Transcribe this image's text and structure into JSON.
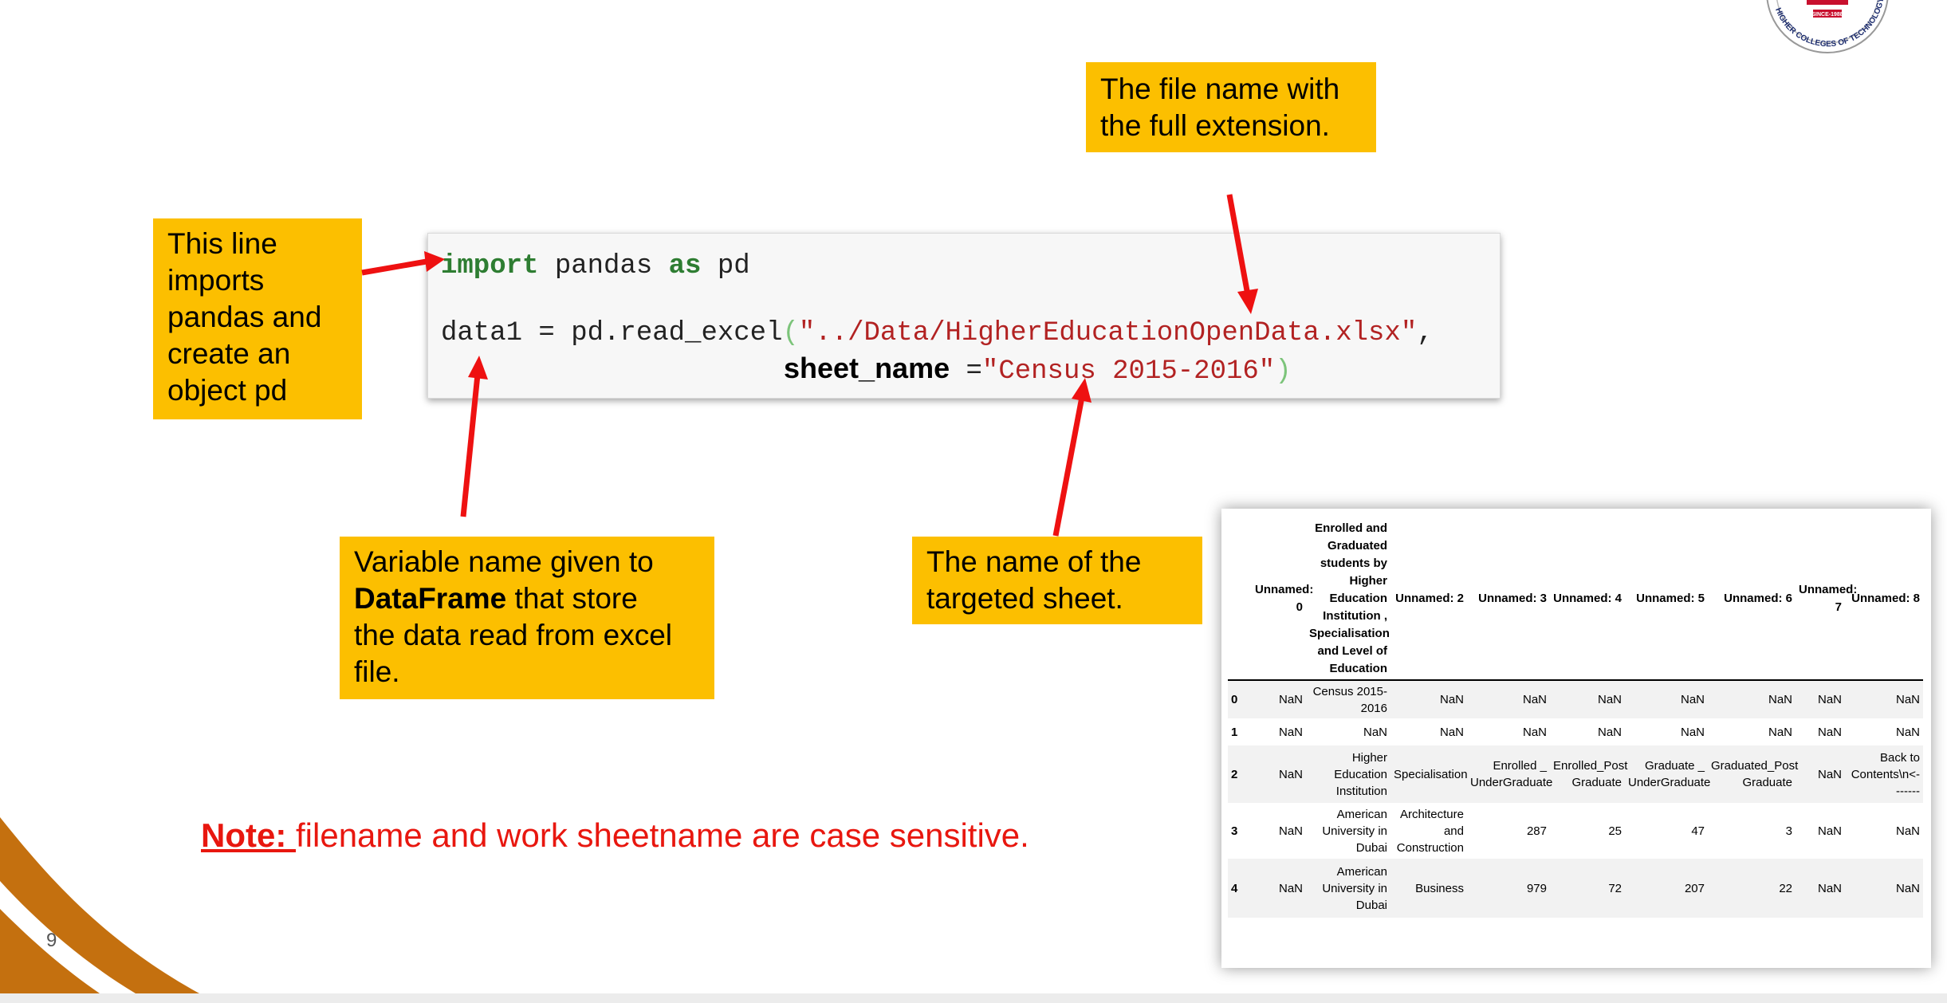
{
  "callouts": {
    "import_note": [
      "This line",
      "imports",
      "pandas and",
      "create an",
      "object pd"
    ],
    "filename_note": [
      "The file name with",
      "the full extension."
    ],
    "variable_note": {
      "pre": "Variable name given to",
      "bold": "DataFrame",
      "post": " that store",
      "line3": "the data read from excel",
      "line4": "file."
    },
    "sheet_note": [
      "The name of the",
      "targeted sheet."
    ]
  },
  "code": {
    "line1": {
      "kw1": "import",
      "mid": " pandas ",
      "kw2": "as",
      "end": " pd"
    },
    "line2": {
      "pre": "data1 = pd.read_excel",
      "open": "(",
      "str": "\"../Data/HigherEducationOpenData.xlsx\"",
      "end": ","
    },
    "line3": {
      "label": "sheet_name",
      "eq": " =",
      "str": "\"Census 2015-2016\"",
      "close": ")"
    }
  },
  "note": {
    "label": "Note: ",
    "text": "filename and work sheetname are case sensitive."
  },
  "page_number": "9",
  "logo": {
    "since": "SINCE-1988",
    "arc_text": "HIGHER COLLEGES OF TECHNOLOGY",
    "brand_color": "#c8102e"
  },
  "colors": {
    "callout": "#fcbf00",
    "arrow": "#ee1111",
    "accent_wave": "#c4700f"
  },
  "dataframe": {
    "headers": [
      "",
      "Unnamed: 0",
      "Enrolled and Graduated students by Higher Education Institution , Specialisation and Level of Education",
      "Unnamed: 2",
      "Unnamed: 3",
      "Unnamed: 4",
      "Unnamed: 5",
      "Unnamed: 6",
      "Unnamed: 7",
      "Unnamed: 8"
    ],
    "rows": [
      [
        "0",
        "NaN",
        "Census 2015-2016",
        "NaN",
        "NaN",
        "NaN",
        "NaN",
        "NaN",
        "NaN",
        "NaN"
      ],
      [
        "1",
        "NaN",
        "NaN",
        "NaN",
        "NaN",
        "NaN",
        "NaN",
        "NaN",
        "NaN",
        "NaN"
      ],
      [
        "2",
        "NaN",
        "Higher Education Institution",
        "Specialisation",
        "Enrolled _ UnderGraduate",
        "Enrolled_Post Graduate",
        "Graduate _ UnderGraduate",
        "Graduated_Post Graduate",
        "NaN",
        "Back to Contents\\n<-------"
      ],
      [
        "3",
        "NaN",
        "American University in Dubai",
        "Architecture and Construction",
        "287",
        "25",
        "47",
        "3",
        "NaN",
        "NaN"
      ],
      [
        "4",
        "NaN",
        "American University in Dubai",
        "Business",
        "979",
        "72",
        "207",
        "22",
        "NaN",
        "NaN"
      ]
    ]
  }
}
